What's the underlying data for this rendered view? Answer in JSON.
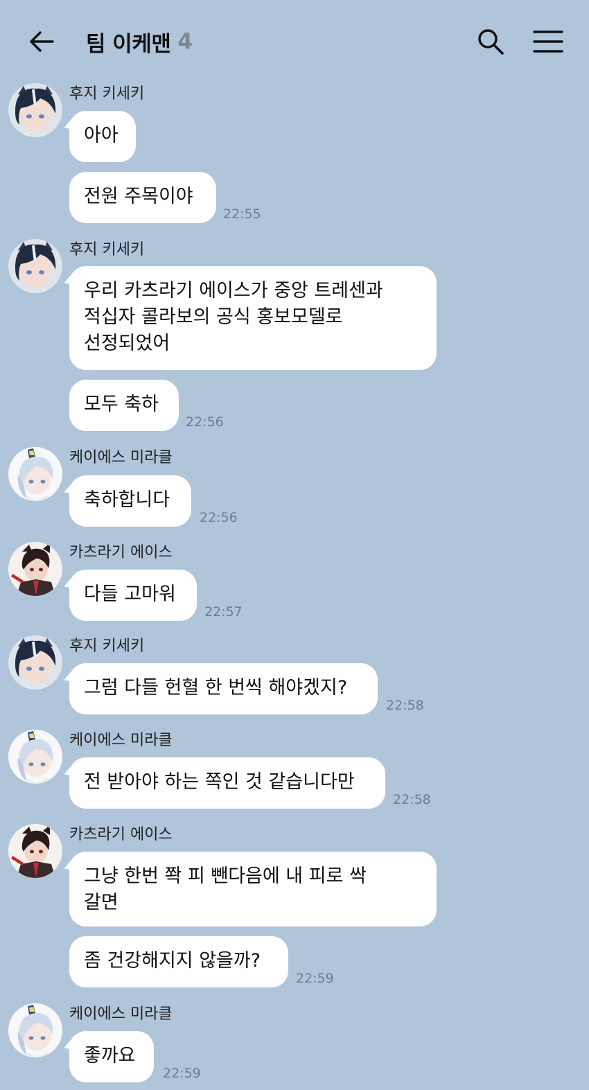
{
  "header": {
    "title": "팀 이케맨",
    "member_count": "4",
    "back_icon": "back-arrow-icon",
    "search_icon": "search-icon",
    "menu_icon": "menu-icon"
  },
  "colors": {
    "background": "#b0c5da",
    "bubble": "#ffffff",
    "timestamp": "#6f7c89"
  },
  "messages": [
    {
      "sender": "후지 키세키",
      "avatar": "fuji-kiseki-avatar",
      "bubbles": [
        {
          "text": "아아",
          "time": ""
        },
        {
          "text": "전원 주목이야",
          "time": "22:55"
        }
      ]
    },
    {
      "sender": "후지 키세키",
      "avatar": "fuji-kiseki-avatar",
      "bubbles": [
        {
          "text": "우리 카츠라기 에이스가 중앙 트레센과\n적십자 콜라보의 공식 홍보모델로\n선정되었어",
          "time": ""
        },
        {
          "text": "모두 축하",
          "time": "22:56"
        }
      ]
    },
    {
      "sender": "케이에스 미라클",
      "avatar": "k-s-miracle-avatar",
      "bubbles": [
        {
          "text": "축하합니다",
          "time": "22:56"
        }
      ]
    },
    {
      "sender": "카츠라기 에이스",
      "avatar": "katsuragi-ace-avatar",
      "bubbles": [
        {
          "text": "다들 고마워",
          "time": "22:57"
        }
      ]
    },
    {
      "sender": "후지 키세키",
      "avatar": "fuji-kiseki-avatar",
      "bubbles": [
        {
          "text": "그럼 다들 헌혈 한 번씩 해야겠지?",
          "time": "22:58"
        }
      ]
    },
    {
      "sender": "케이에스 미라클",
      "avatar": "k-s-miracle-avatar",
      "bubbles": [
        {
          "text": "전 받아야 하는 쪽인 것 같습니다만",
          "time": "22:58"
        }
      ]
    },
    {
      "sender": "카츠라기 에이스",
      "avatar": "katsuragi-ace-avatar",
      "bubbles": [
        {
          "text": "그냥 한번 쫙 피 뺀다음에 내 피로 싹\n갈면",
          "time": ""
        },
        {
          "text": "좀 건강해지지 않을까?",
          "time": "22:59"
        }
      ]
    },
    {
      "sender": "케이에스 미라클",
      "avatar": "k-s-miracle-avatar",
      "bubbles": [
        {
          "text": "좋까요",
          "time": "22:59"
        }
      ]
    }
  ]
}
